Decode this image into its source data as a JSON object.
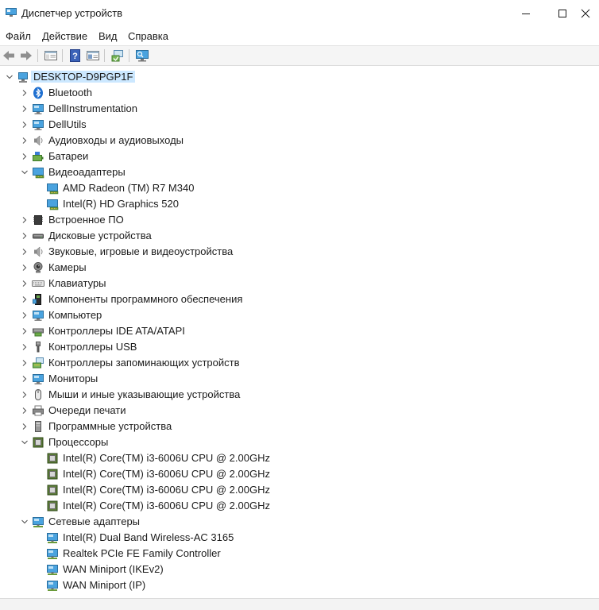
{
  "window": {
    "title": "Диспетчер устройств"
  },
  "menu": [
    "Файл",
    "Действие",
    "Вид",
    "Справка"
  ],
  "toolbar": [
    "back-icon",
    "forward-icon",
    "properties-view-icon",
    "help-icon",
    "properties-icon",
    "update-driver-icon",
    "monitor-scan-icon"
  ],
  "tree": [
    {
      "label": "DESKTOP-D9PGP1F",
      "level": 0,
      "state": "expanded",
      "icon": "computer-icon",
      "root": true
    },
    {
      "label": "Bluetooth",
      "level": 1,
      "state": "collapsed",
      "icon": "bluetooth-icon"
    },
    {
      "label": "DellInstrumentation",
      "level": 1,
      "state": "collapsed",
      "icon": "monitor-icon"
    },
    {
      "label": "DellUtils",
      "level": 1,
      "state": "collapsed",
      "icon": "monitor-icon"
    },
    {
      "label": "Аудиовходы и аудиовыходы",
      "level": 1,
      "state": "collapsed",
      "icon": "speaker-icon"
    },
    {
      "label": "Батареи",
      "level": 1,
      "state": "collapsed",
      "icon": "battery-icon"
    },
    {
      "label": "Видеоадаптеры",
      "level": 1,
      "state": "expanded",
      "icon": "display-adapter-icon"
    },
    {
      "label": "AMD Radeon (TM) R7 M340",
      "level": 2,
      "state": "leaf",
      "icon": "display-adapter-icon"
    },
    {
      "label": "Intel(R) HD Graphics 520",
      "level": 2,
      "state": "leaf",
      "icon": "display-adapter-icon"
    },
    {
      "label": "Встроенное ПО",
      "level": 1,
      "state": "collapsed",
      "icon": "firmware-icon"
    },
    {
      "label": "Дисковые устройства",
      "level": 1,
      "state": "collapsed",
      "icon": "disk-icon"
    },
    {
      "label": "Звуковые, игровые и видеоустройства",
      "level": 1,
      "state": "collapsed",
      "icon": "speaker-icon"
    },
    {
      "label": "Камеры",
      "level": 1,
      "state": "collapsed",
      "icon": "camera-icon"
    },
    {
      "label": "Клавиатуры",
      "level": 1,
      "state": "collapsed",
      "icon": "keyboard-icon"
    },
    {
      "label": "Компоненты программного обеспечения",
      "level": 1,
      "state": "collapsed",
      "icon": "software-component-icon"
    },
    {
      "label": "Компьютер",
      "level": 1,
      "state": "collapsed",
      "icon": "monitor-icon"
    },
    {
      "label": "Контроллеры IDE ATA/ATAPI",
      "level": 1,
      "state": "collapsed",
      "icon": "ide-controller-icon"
    },
    {
      "label": "Контроллеры USB",
      "level": 1,
      "state": "collapsed",
      "icon": "usb-icon"
    },
    {
      "label": "Контроллеры запоминающих устройств",
      "level": 1,
      "state": "collapsed",
      "icon": "storage-controller-icon"
    },
    {
      "label": "Мониторы",
      "level": 1,
      "state": "collapsed",
      "icon": "monitor-icon"
    },
    {
      "label": "Мыши и иные указывающие устройства",
      "level": 1,
      "state": "collapsed",
      "icon": "mouse-icon"
    },
    {
      "label": "Очереди печати",
      "level": 1,
      "state": "collapsed",
      "icon": "printer-icon"
    },
    {
      "label": "Программные устройства",
      "level": 1,
      "state": "collapsed",
      "icon": "software-device-icon"
    },
    {
      "label": "Процессоры",
      "level": 1,
      "state": "expanded",
      "icon": "processor-icon"
    },
    {
      "label": "Intel(R) Core(TM) i3-6006U CPU @ 2.00GHz",
      "level": 2,
      "state": "leaf",
      "icon": "processor-icon"
    },
    {
      "label": "Intel(R) Core(TM) i3-6006U CPU @ 2.00GHz",
      "level": 2,
      "state": "leaf",
      "icon": "processor-icon"
    },
    {
      "label": "Intel(R) Core(TM) i3-6006U CPU @ 2.00GHz",
      "level": 2,
      "state": "leaf",
      "icon": "processor-icon"
    },
    {
      "label": "Intel(R) Core(TM) i3-6006U CPU @ 2.00GHz",
      "level": 2,
      "state": "leaf",
      "icon": "processor-icon"
    },
    {
      "label": "Сетевые адаптеры",
      "level": 1,
      "state": "expanded",
      "icon": "network-adapter-icon"
    },
    {
      "label": "Intel(R) Dual Band Wireless-AC 3165",
      "level": 2,
      "state": "leaf",
      "icon": "network-adapter-icon"
    },
    {
      "label": "Realtek PCIe FE Family Controller",
      "level": 2,
      "state": "leaf",
      "icon": "network-adapter-icon"
    },
    {
      "label": "WAN Miniport (IKEv2)",
      "level": 2,
      "state": "leaf",
      "icon": "network-adapter-icon"
    },
    {
      "label": "WAN Miniport (IP)",
      "level": 2,
      "state": "leaf",
      "icon": "network-adapter-icon"
    }
  ]
}
